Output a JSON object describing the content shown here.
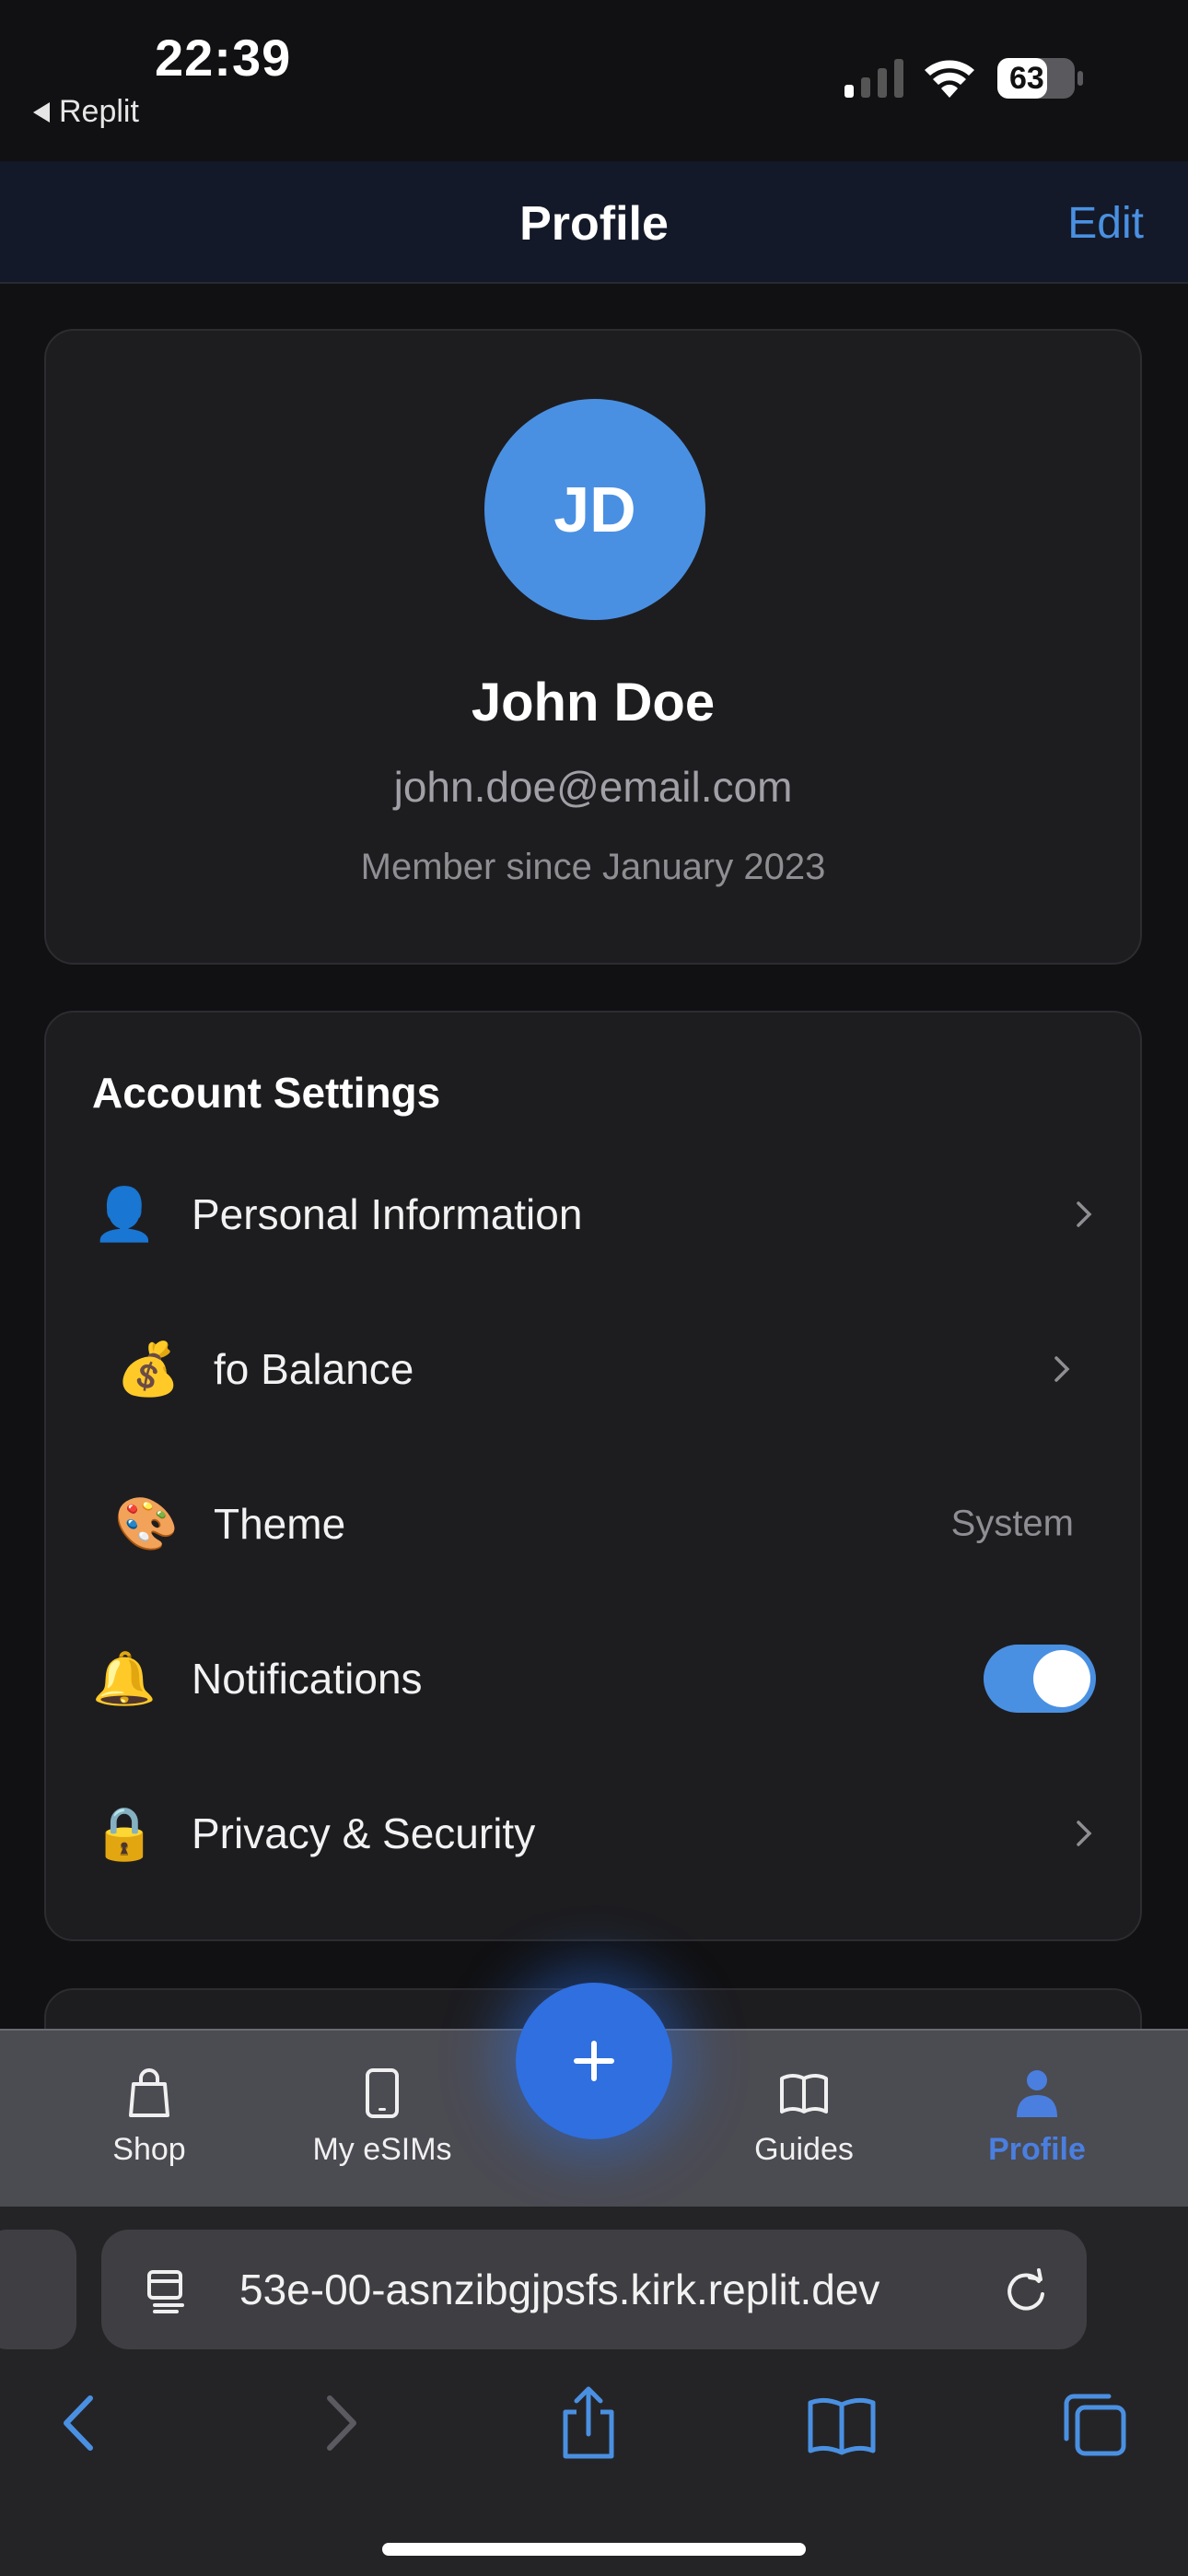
{
  "status_bar": {
    "time": "22:39",
    "back_app": "Replit",
    "battery": "63"
  },
  "nav": {
    "title": "Profile",
    "edit_label": "Edit"
  },
  "profile": {
    "initials": "JD",
    "name": "John Doe",
    "email": "john.doe@email.com",
    "member_since": "Member since January 2023"
  },
  "account_settings": {
    "heading": "Account Settings",
    "items": [
      {
        "icon": "person-icon",
        "emoji": "👤",
        "label": "Personal Information"
      },
      {
        "icon": "money-bag-icon",
        "emoji": "💰",
        "label": "fo Balance"
      },
      {
        "icon": "palette-icon",
        "emoji": "🎨",
        "label": "Theme",
        "value": "System"
      },
      {
        "icon": "bell-icon",
        "emoji": "🔔",
        "label": "Notifications",
        "toggle_on": true
      },
      {
        "icon": "lock-icon",
        "emoji": "🔒",
        "label": "Privacy & Security"
      }
    ]
  },
  "tab_bar": {
    "tabs": [
      {
        "icon": "shopping-bag-icon",
        "label": "Shop"
      },
      {
        "icon": "phone-icon",
        "label": "My eSIMs"
      },
      {
        "icon": "book-icon",
        "label": "Guides"
      },
      {
        "icon": "person-icon",
        "label": "Profile",
        "active": true
      }
    ],
    "fab_icon": "plus-icon",
    "active_color": "#4a7fe0"
  },
  "browser": {
    "url": "53e-00-asnzibgjpsfs.kirk.replit.dev"
  },
  "colors": {
    "accent": "#4a90e2",
    "background": "#111113",
    "card": "#1d1d20"
  }
}
